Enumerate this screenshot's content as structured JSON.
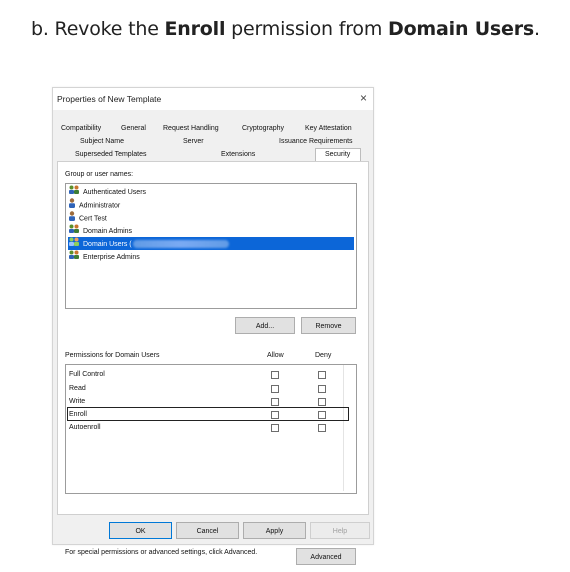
{
  "instruction": {
    "prefix": "b. Revoke the ",
    "bold1": "Enroll",
    "middle": " permission from ",
    "bold2": "Domain Users",
    "suffix": "."
  },
  "dialog": {
    "title": "Properties of New Template",
    "close_glyph": "×",
    "tabs_row1": [
      "Compatibility",
      "General",
      "Request Handling",
      "Cryptography",
      "Key Attestation"
    ],
    "tabs_row2": [
      "Subject Name",
      "Server",
      "Issuance Requirements"
    ],
    "tabs_row3": [
      "Superseded Templates",
      "Extensions",
      "Security"
    ],
    "group_label": "Group or user names:",
    "users": [
      {
        "name": "Authenticated Users",
        "icon": "group-icon"
      },
      {
        "name": "Administrator",
        "icon": "user-icon"
      },
      {
        "name": "Cert Test",
        "icon": "user-icon"
      },
      {
        "name": "Domain Admins",
        "icon": "group-icon"
      },
      {
        "name": "Domain Users (",
        "icon": "group-icon"
      },
      {
        "name": "Enterprise Admins",
        "icon": "group-icon"
      }
    ],
    "add_button": "Add...",
    "remove_button": "Remove",
    "permissions_label": "Permissions for Domain Users",
    "allow_header": "Allow",
    "deny_header": "Deny",
    "permissions": [
      "Full Control",
      "Read",
      "Write",
      "Enroll",
      "Autoenroll"
    ],
    "advanced_note": "For special permissions or advanced settings, click Advanced.",
    "advanced_button": "Advanced",
    "ok_button": "OK",
    "cancel_button": "Cancel",
    "apply_button": "Apply",
    "help_button": "Help",
    "colors": {
      "selection": "#0c66d8",
      "primary_border": "#0078d7"
    }
  }
}
